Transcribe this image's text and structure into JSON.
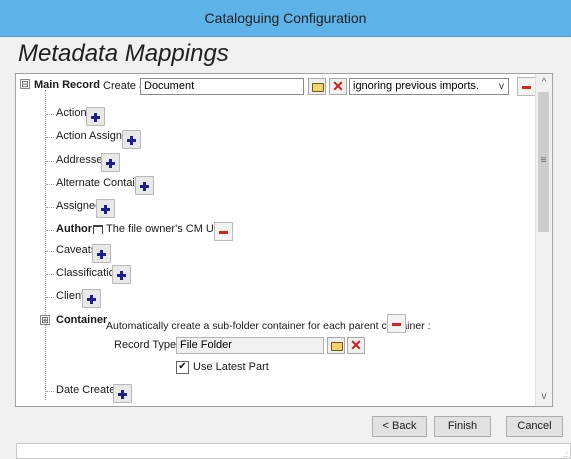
{
  "window": {
    "title": "Cataloguing Configuration"
  },
  "page": {
    "heading": "Metadata Mappings"
  },
  "main_record": {
    "label": "Main Record",
    "create_label": "Create a",
    "record_type": "Document",
    "import_mode": "ignoring previous imports."
  },
  "fields": {
    "action": "Action",
    "action_assignee": "Action Assignee",
    "addressee": "Addressee",
    "alternate_container": "Alternate Container",
    "assignee": "Assignee",
    "author": "Author",
    "author_value": "The file owner's CM User",
    "caveats": "Caveats",
    "classification": "Classification",
    "client": "Client",
    "container": "Container",
    "container_desc": "Automatically create a sub-folder container for each parent container :",
    "record_type_label": "Record Type :",
    "record_type_value": "File Folder",
    "use_latest_part": "Use Latest Part",
    "date_created": "Date Created"
  },
  "footer": {
    "back": "< Back",
    "finish": "Finish",
    "cancel": "Cancel"
  },
  "icons": {
    "expand_collapse": "⊟",
    "expand": "⊞",
    "checkmark": "✔",
    "x": "✕",
    "scroll_up": "^",
    "scroll_down": "v",
    "grip": "≡"
  }
}
